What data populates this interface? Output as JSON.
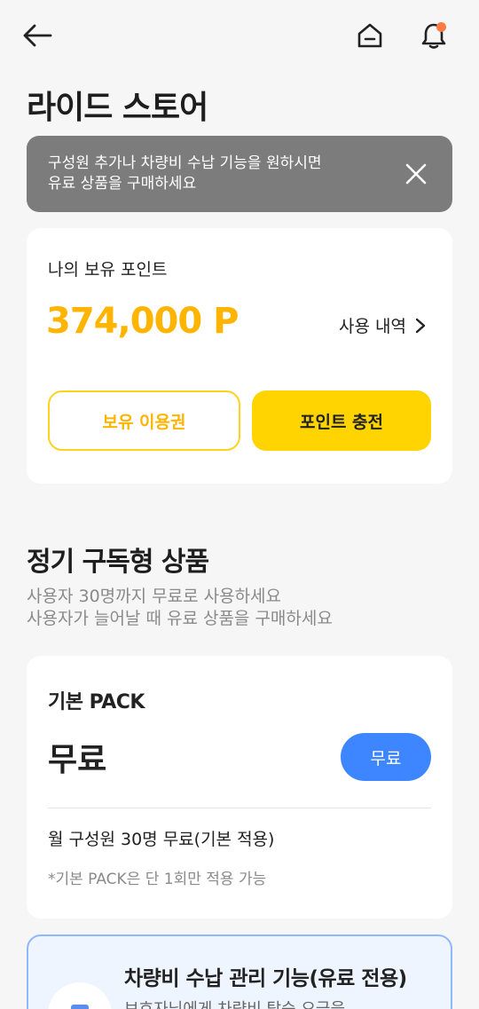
{
  "header": {
    "back_icon": "arrow-left-icon",
    "home_icon": "home-icon",
    "bell_icon": "bell-icon",
    "notification_dot_color": "#ff7a45"
  },
  "page": {
    "title": "라이드 스토어"
  },
  "banner": {
    "line1": "구성원 추가나 차량비 수납 기능을 원하시면",
    "line2": "유료 상품을 구매하세요",
    "close_icon": "close-icon"
  },
  "points": {
    "label": "나의 보유 포인트",
    "value": "374,000 P",
    "usage_link": "사용 내역",
    "owned_pass_button": "보유 이용권",
    "charge_button": "포인트 충전",
    "accent_color": "#ffb400"
  },
  "subscription": {
    "title": "정기 구독형 상품",
    "desc_line1": "사용자 30명까지 무료로 사용하세요",
    "desc_line2": "사용자가 늘어날 때 유료 상품을 구매하세요"
  },
  "basic_pack": {
    "name": "기본 PACK",
    "price": "무료",
    "button": "무료",
    "detail": "월 구성원 30명 무료(기본 적용)",
    "note": "*기본 PACK은 단 1회만 적용 가능"
  },
  "feature": {
    "title": "차량비 수납 관리 기능(유료 전용)",
    "subtitle": "보호자님에게 차량비 탑승 요금을"
  }
}
